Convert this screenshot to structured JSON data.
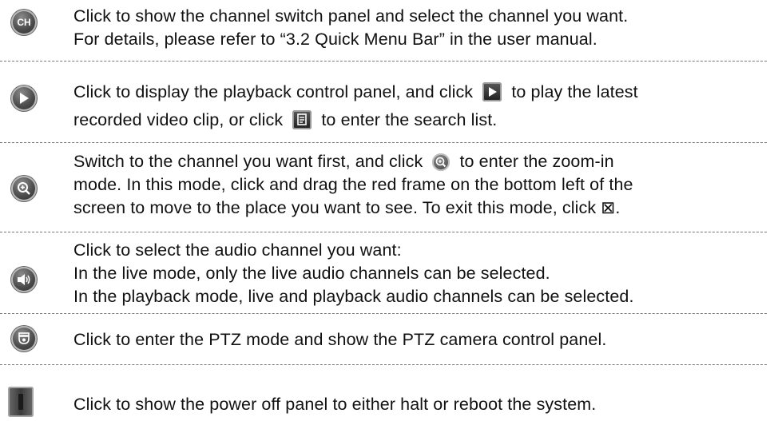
{
  "rows": [
    {
      "icon": "ch-channel-icon",
      "ch_label": "CH",
      "lines": [
        "Click to show the channel switch panel and select the channel you want.",
        "For details, please refer to “3.2 Quick Menu Bar” in the user manual."
      ]
    },
    {
      "icon": "playback-icon",
      "line1_a": "Click to display the playback control panel, and click",
      "line1_b": "to play the latest",
      "line2_a": "recorded video clip, or click",
      "line2_b": "to enter the search list."
    },
    {
      "icon": "zoom-icon",
      "line1_a": "Switch to the channel you want first, and click",
      "line1_b": "to enter the zoom-in",
      "line2": "mode. In this mode, click and drag the red frame on the bottom left of the",
      "line3": "screen to move to the place you want to see. To exit this mode, click ⊠."
    },
    {
      "icon": "audio-icon",
      "lines": [
        "Click to select the audio channel you want:",
        "In the live mode, only the live audio channels can be selected.",
        "In the playback mode, live and playback audio channels can be selected."
      ]
    },
    {
      "icon": "ptz-camera-icon",
      "lines": [
        "Click to enter the PTZ mode and show the PTZ camera control panel."
      ]
    },
    {
      "icon": "power-icon",
      "lines": [
        "Click to show the power off panel to either halt or reboot the system."
      ]
    }
  ]
}
